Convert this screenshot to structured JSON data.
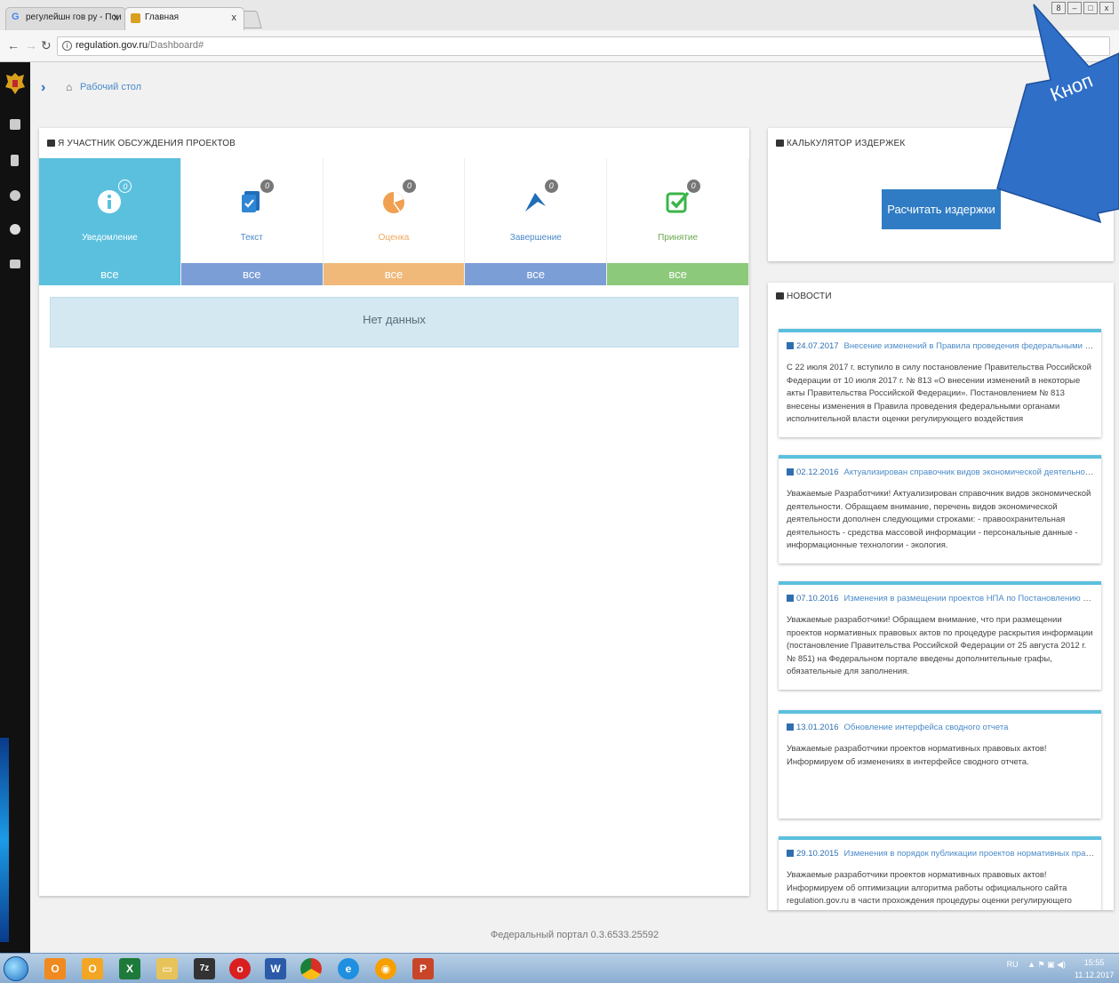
{
  "browser": {
    "tabs": [
      {
        "title": "регулейшн гов ру - Пои",
        "close": "x"
      },
      {
        "title": "Главная",
        "close": "x"
      }
    ],
    "window_controls": [
      "8",
      "–",
      "□",
      "x"
    ],
    "url_host": "regulation.gov.ru",
    "url_path": "/Dashboard#"
  },
  "breadcrumb": {
    "home_icon": "home-icon",
    "label": "Рабочий стол"
  },
  "projects_panel": {
    "title": "Я УЧАСТНИК ОБСУЖДЕНИЯ ПРОЕКТОВ",
    "tiles": [
      {
        "label": "Уведомление",
        "count": "0",
        "all": "все",
        "icon": "info-icon",
        "color": "#5bc0de",
        "active": true
      },
      {
        "label": "Текст",
        "count": "0",
        "all": "все",
        "icon": "text-document-icon",
        "color": "#7b9ed6",
        "active": false
      },
      {
        "label": "Оценка",
        "count": "0",
        "all": "все",
        "icon": "pie-chart-icon",
        "color": "#f0b97a",
        "active": false
      },
      {
        "label": "Завершение",
        "count": "0",
        "all": "все",
        "icon": "flag-icon",
        "color": "#7b9ed6",
        "active": false
      },
      {
        "label": "Принятие",
        "count": "0",
        "all": "все",
        "icon": "check-icon",
        "color": "#8cc97a",
        "active": false
      }
    ],
    "no_data": "Нет данных"
  },
  "calculator_panel": {
    "title": "КАЛЬКУЛЯТОР ИЗДЕРЖЕК",
    "button": "Расчитать издержки"
  },
  "news_panel": {
    "title": "НОВОСТИ",
    "items": [
      {
        "date": "24.07.2017",
        "title": "Внесение изменений в Правила проведения федеральными органами испо...",
        "body": "С 22 июля 2017 г. вступило в силу постановление Правительства Российской Федерации от 10 июля 2017 г. № 813 «О внесении изменений в некоторые акты Правительства Российской Федерации». Постановлением № 813 внесены изменения в Правила проведения федеральными органами исполнительной власти оценки регулирующего воздействия"
      },
      {
        "date": "02.12.2016",
        "title": "Актуализирован справочник видов экономической деятельности",
        "body": "Уважаемые Разработчики! Актуализирован справочник видов экономической деятельности. Обращаем внимание, перечень видов экономической деятельности дополнен следующими строками: - правоохранительная деятельность - средства массовой информации - персональные данные - информационные технологии - экология."
      },
      {
        "date": "07.10.2016",
        "title": "Изменения в размещении проектов НПА по Постановлению Правительства ...",
        "body": "Уважаемые разработчики! Обращаем внимание, что при размещении проектов нормативных правовых актов по процедуре раскрытия информации (постановление Правительства Российской Федерации от 25 августа 2012 г. № 851) на Федеральном портале введены дополнительные графы, обязательные для заполнения."
      },
      {
        "date": "13.01.2016",
        "title": "Обновление интерфейса сводного отчета",
        "body": "Уважаемые разработчики проектов нормативных правовых актов! Информируем об изменениях в интерфейсе сводного отчета."
      },
      {
        "date": "29.10.2015",
        "title": "Изменения в порядок публикации проектов нормативных правовых актов",
        "body": "Уважаемые разработчики проектов нормативных правовых актов! Информируем об оптимизации алгоритма работы официального сайта regulation.gov.ru в части прохождения процедуры оценки регулирующего воздействия и независимой антикоррупционной"
      }
    ]
  },
  "footer": "Федеральный портал 0.3.6533.25592",
  "callout": {
    "text": "Кноп",
    "color": "#2f6fc8"
  },
  "taskbar": {
    "apps": [
      "windows-start",
      "outlook",
      "office",
      "excel",
      "explorer",
      "7zip",
      "opera",
      "word",
      "chrome",
      "internet-explorer",
      "browser",
      "powerpoint"
    ],
    "tray_lang": "RU",
    "time": "15:55",
    "date": "11.12.2017"
  }
}
